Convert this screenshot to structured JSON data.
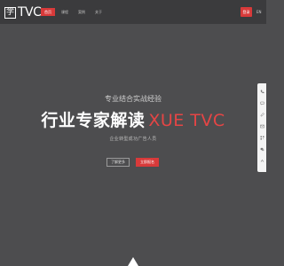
{
  "header": {
    "logo_mark": "学",
    "logo_text": "TVC",
    "nav": [
      {
        "label": "首页"
      },
      {
        "label": "课程"
      },
      {
        "label": "案例"
      },
      {
        "label": "关于"
      }
    ],
    "login_label": "登录",
    "lang_label": "EN"
  },
  "hero": {
    "eyebrow": "专业结合实战经验",
    "title_main": "行业专家解读",
    "title_accent": "XUE TVC",
    "subtitle": "企业转型成功广告人员",
    "btn_learn": "了解更多",
    "btn_apply": "立即报名"
  },
  "sidebar": {
    "icons": [
      "phone-icon",
      "chat-icon",
      "edit-icon",
      "mail-icon",
      "qr-icon",
      "wechat-icon",
      "top-icon"
    ]
  },
  "colors": {
    "accent": "#d83a3a",
    "background": "#4d4d4f",
    "header": "#3b3b3d"
  }
}
